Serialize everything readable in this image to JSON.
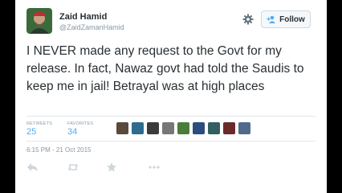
{
  "tweet": {
    "author_name": "Zaid Hamid",
    "author_handle": "@ZaidZamanHamid",
    "text": "I NEVER made any request to the Govt for my release. In fact, Nawaz govt had told the Saudis to keep me in jail! Betrayal was at high places",
    "timestamp": "6:15 PM - 21 Oct 2015"
  },
  "header": {
    "follow_label": "Follow",
    "gear_icon": "gear-icon",
    "follow_icon": "person-add-icon"
  },
  "stats": {
    "retweets_label": "RETWEETS",
    "retweets_value": "25",
    "favorites_label": "FAVORITES",
    "favorites_value": "34"
  },
  "favoriters": [
    {
      "color": "#5a4a3c"
    },
    {
      "color": "#2d6b8f"
    },
    {
      "color": "#3b3b3b"
    },
    {
      "color": "#777777"
    },
    {
      "color": "#4a7d3a"
    },
    {
      "color": "#2b4c7e"
    },
    {
      "color": "#355e60"
    },
    {
      "color": "#6b2b2b"
    },
    {
      "color": "#4f6a8c"
    }
  ],
  "actions": [
    "reply-icon",
    "retweet-icon",
    "favorite-icon",
    "more-icon"
  ],
  "colors": {
    "link": "#55acee",
    "muted": "#8899a6",
    "text": "#292f33"
  }
}
